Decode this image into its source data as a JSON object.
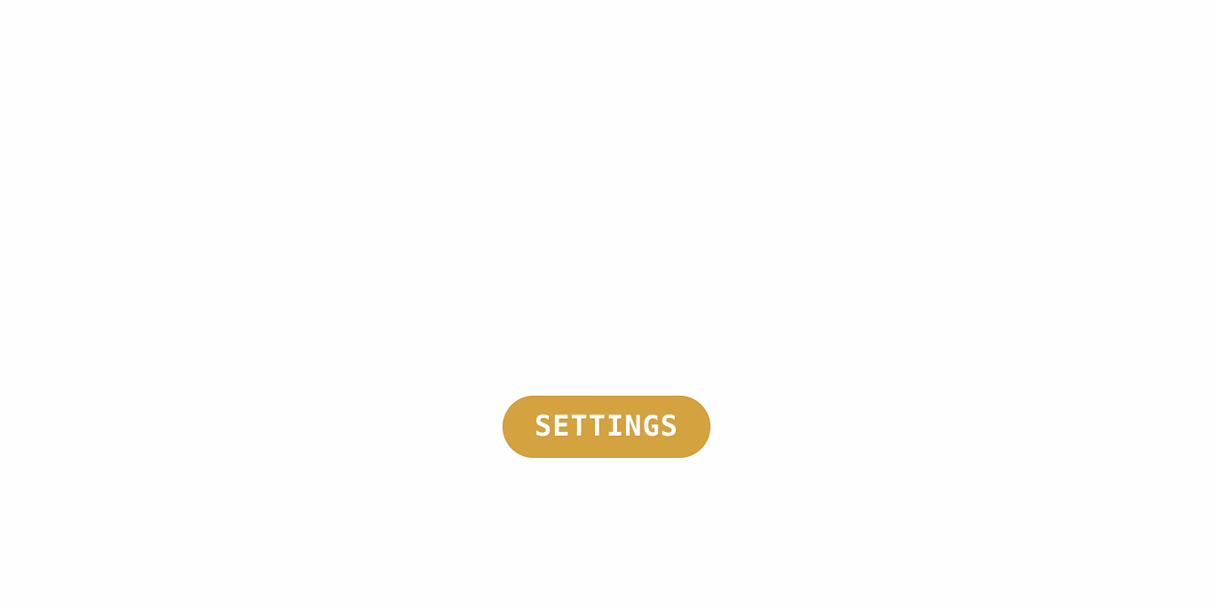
{
  "menu": {
    "settings_label": "SETTINGS"
  },
  "colors": {
    "background": "#fefefe",
    "button": "#d4a23e",
    "button_text": "#ffffff"
  }
}
